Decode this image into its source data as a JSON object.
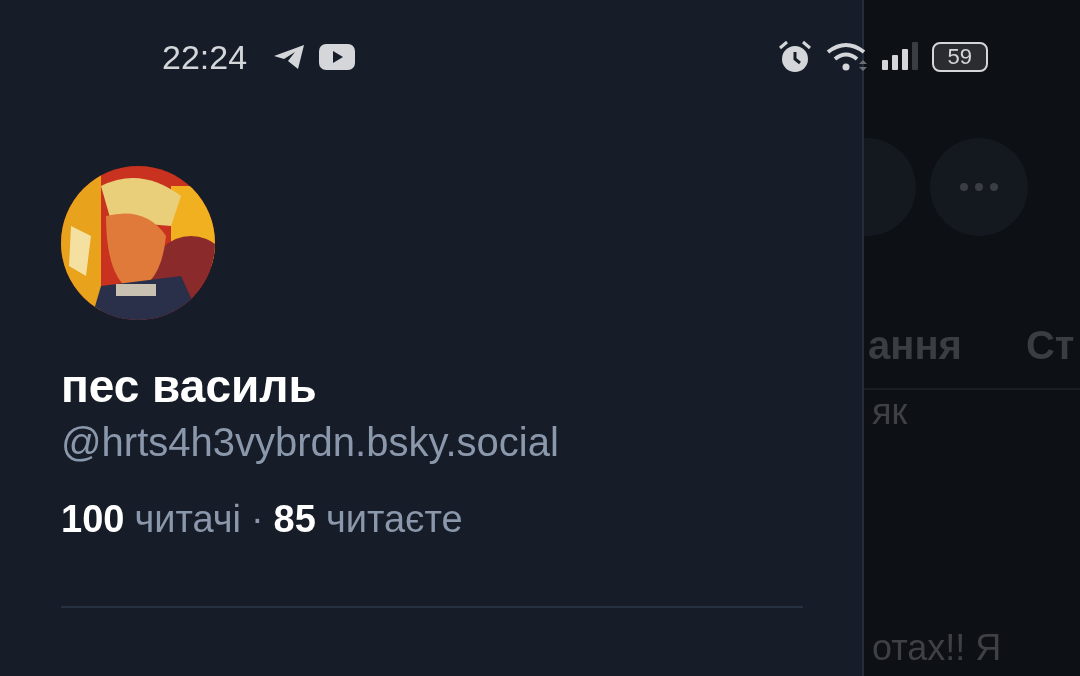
{
  "status_bar": {
    "time": "22:24",
    "battery": "59"
  },
  "drawer": {
    "display_name": "пес василь",
    "handle": "@hrts4h3vybrdn.bsky.social",
    "followers_count": "100",
    "followers_label": "читачі",
    "separator": "·",
    "following_count": "85",
    "following_label": "читаєте"
  },
  "background": {
    "tabs": [
      "ання",
      "Ст"
    ],
    "posts": [
      "як",
      "отах!! Я"
    ]
  }
}
